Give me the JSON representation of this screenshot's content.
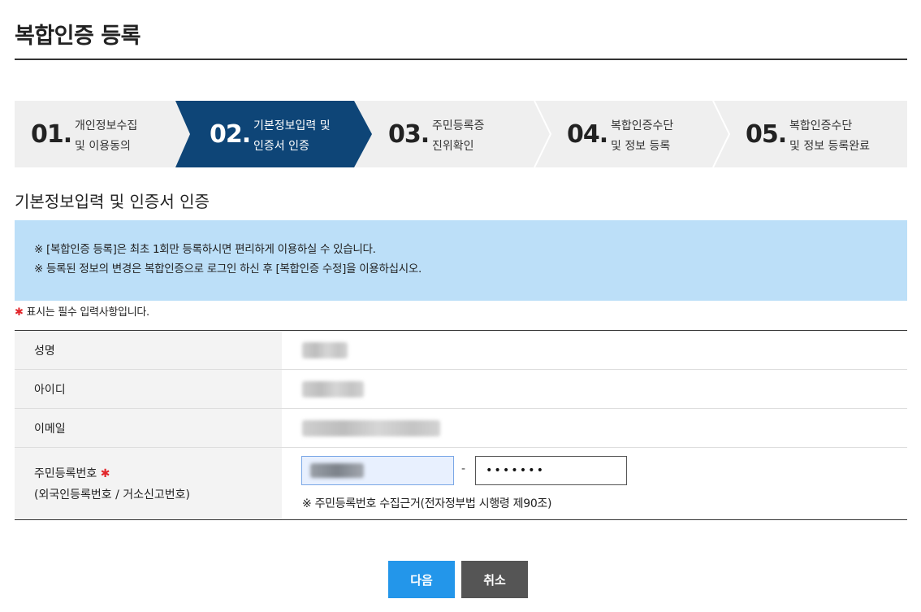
{
  "page": {
    "title": "복합인증 등록"
  },
  "steps": [
    {
      "num": "01.",
      "line1": "개인정보수집",
      "line2": "및 이용동의",
      "active": false
    },
    {
      "num": "02.",
      "line1": "기본정보입력 및",
      "line2": "인증서 인증",
      "active": true
    },
    {
      "num": "03.",
      "line1": "주민등록증",
      "line2": "진위확인",
      "active": false
    },
    {
      "num": "04.",
      "line1": "복합인증수단",
      "line2": "및 정보 등록",
      "active": false
    },
    {
      "num": "05.",
      "line1": "복합인증수단",
      "line2": "및 정보 등록완료",
      "active": false
    }
  ],
  "colors": {
    "active_step": "#0e4577",
    "notice_bg": "#bcdff8",
    "next_button": "#2396ea",
    "cancel_button": "#555555",
    "required": "#e2262b"
  },
  "section": {
    "title": "기본정보입력 및 인증서 인증"
  },
  "notice": {
    "line1": "※ [복합인증 등록]은 최초 1회만 등록하시면 편리하게 이용하실 수 있습니다.",
    "line2": "※ 등록된 정보의 변경은 복합인증으로 로그인 하신 후 [복합인증 수정]을 이용하십시오."
  },
  "required_note": {
    "star": "✱",
    "text": " 표시는 필수 입력사항입니다."
  },
  "form": {
    "name_label": "성명",
    "id_label": "아이디",
    "email_label": "이메일",
    "rrn_label": "주민등록번호",
    "rrn_star": "✱",
    "rrn_sub": "(외국인등록번호 / 거소신고번호)",
    "rrn_dash": "-",
    "rrn_back_value": "•••••••",
    "rrn_basis": "※ 주민등록번호 수집근거(전자정부법 시행령 제90조)"
  },
  "buttons": {
    "next": "다음",
    "cancel": "취소"
  }
}
